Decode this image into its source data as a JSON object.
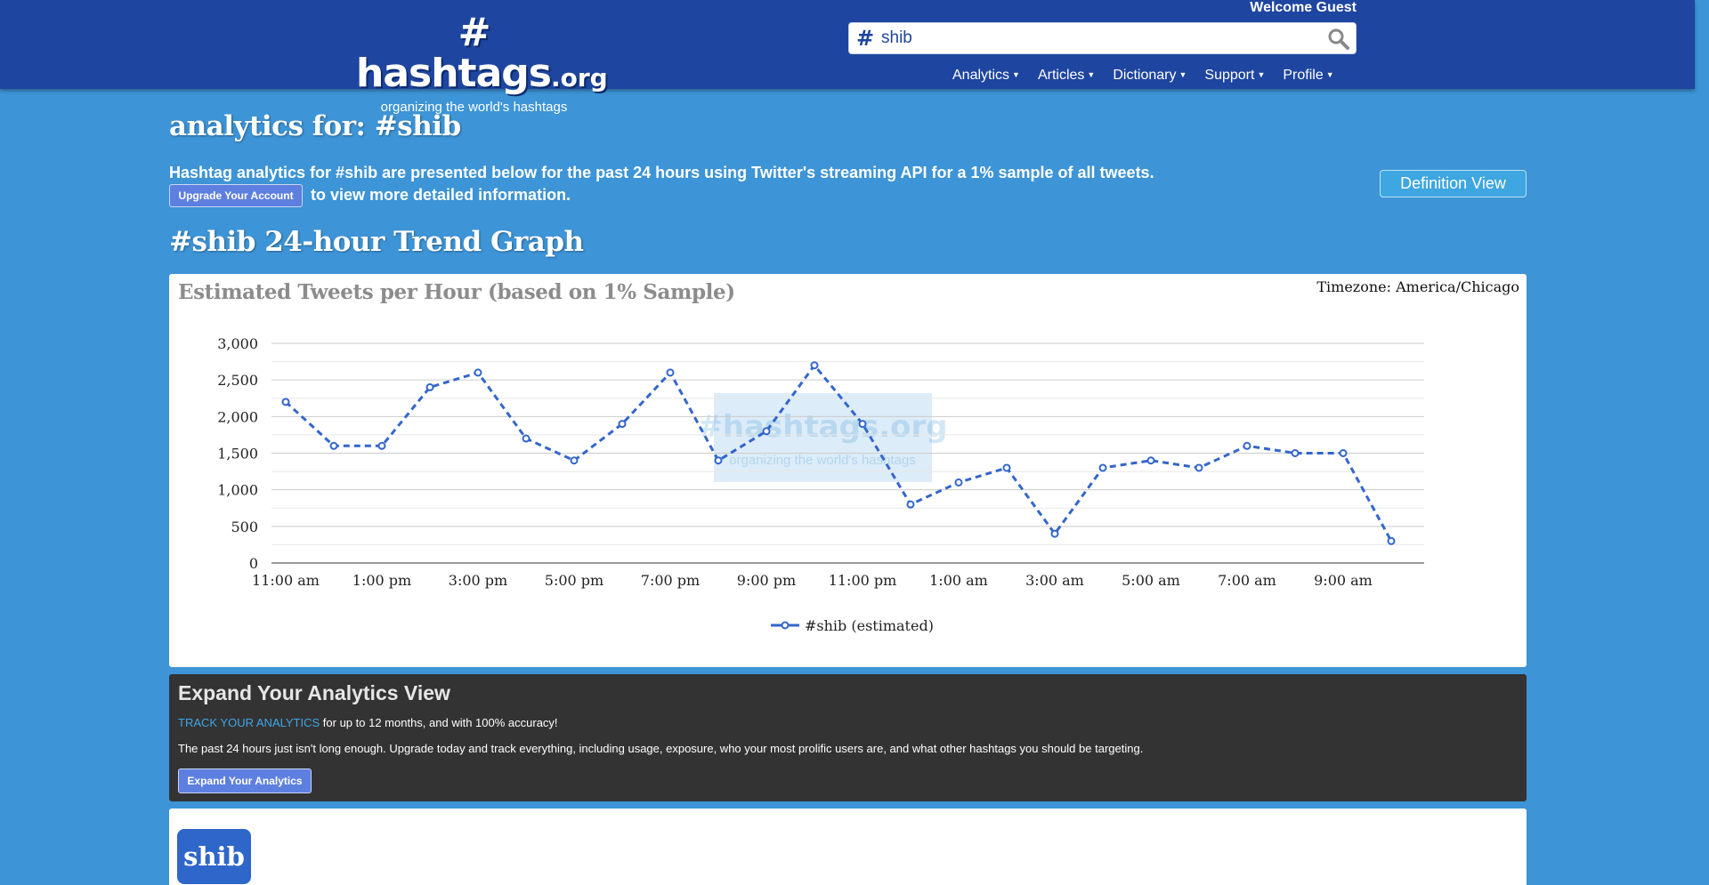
{
  "header": {
    "logo_main": "# hashtags",
    "logo_suffix": ".org",
    "logo_tagline": "organizing the world's hashtags",
    "welcome": "Welcome Guest",
    "search_hash": "#",
    "search_value": "shib",
    "nav": [
      {
        "label": "Analytics"
      },
      {
        "label": "Articles"
      },
      {
        "label": "Dictionary"
      },
      {
        "label": "Support"
      },
      {
        "label": "Profile"
      }
    ]
  },
  "page": {
    "title": "analytics for: #shib",
    "intro_line1": "Hashtag analytics for #shib are presented below for the past 24 hours using Twitter's streaming API for a 1% sample of all tweets.",
    "upgrade_button": "Upgrade Your Account",
    "intro_line2": "to view more detailed information.",
    "definition_button": "Definition View",
    "trend_title": "#shib 24-hour Trend Graph"
  },
  "chart_data": {
    "type": "line",
    "title": "Estimated Tweets per Hour (based on 1% Sample)",
    "timezone": "Timezone: America/Chicago",
    "watermark_main": "#hashtags",
    "watermark_suffix": ".org",
    "watermark_tagline": "organizing the world's hashtags",
    "x": [
      "11:00 am",
      "12:00 pm",
      "1:00 pm",
      "2:00 pm",
      "3:00 pm",
      "4:00 pm",
      "5:00 pm",
      "6:00 pm",
      "7:00 pm",
      "8:00 pm",
      "9:00 pm",
      "10:00 pm",
      "11:00 pm",
      "12:00 am",
      "1:00 am",
      "2:00 am",
      "3:00 am",
      "4:00 am",
      "5:00 am",
      "6:00 am",
      "7:00 am",
      "8:00 am",
      "9:00 am",
      "10:00 am"
    ],
    "x_tick_labels": [
      "11:00 am",
      "1:00 pm",
      "3:00 pm",
      "5:00 pm",
      "7:00 pm",
      "9:00 pm",
      "11:00 pm",
      "1:00 am",
      "3:00 am",
      "5:00 am",
      "7:00 am",
      "9:00 am"
    ],
    "y_tick_labels": [
      "0",
      "500",
      "1,000",
      "1,500",
      "2,000",
      "2,500",
      "3,000"
    ],
    "ylim": [
      0,
      3000
    ],
    "series": [
      {
        "name": "#shib (estimated)",
        "color": "#3366cc",
        "values": [
          2200,
          1600,
          1600,
          2400,
          2600,
          1700,
          1400,
          1900,
          2600,
          1400,
          1800,
          2700,
          1900,
          800,
          1100,
          1300,
          400,
          1300,
          1400,
          1300,
          1600,
          1500,
          1500,
          300
        ]
      }
    ],
    "grid": true,
    "legend": "bottom"
  },
  "expand": {
    "title": "Expand Your Analytics View",
    "link_text": "TRACK YOUR ANALYTICS",
    "line1_rest": " for up to 12 months, and with 100% accuracy!",
    "line2": "The past 24 hours just isn't long enough. Upgrade today and track everything, including usage, exposure, who your most prolific users are, and what other hashtags you should be targeting.",
    "button": "Expand Your Analytics"
  },
  "bottom": {
    "tag": "shib"
  }
}
